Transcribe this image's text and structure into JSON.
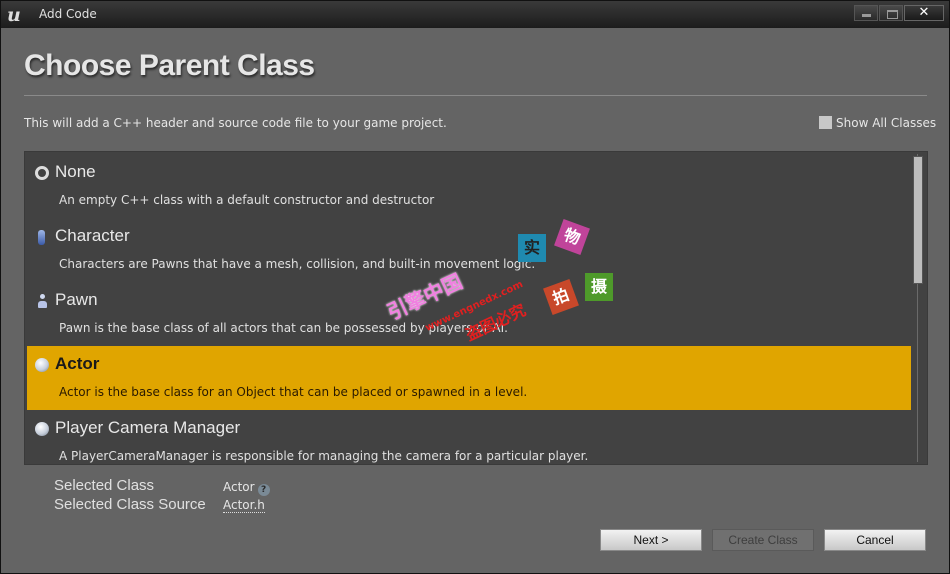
{
  "window": {
    "title": "Add Code",
    "controls": {
      "minimize": "minimize",
      "maximize": "maximize",
      "close": "✕"
    }
  },
  "header": {
    "title": "Choose Parent Class",
    "description": "This will add a C++ header and source code file to your game project.",
    "show_all_classes_label": "Show All Classes",
    "show_all_classes_checked": false
  },
  "classes": [
    {
      "name": "None",
      "description": "An empty C++ class with a default constructor and destructor",
      "icon": "empty-circle-icon",
      "selected": false
    },
    {
      "name": "Character",
      "description": "Characters are Pawns that have a mesh, collision, and built-in movement logic.",
      "icon": "character-icon",
      "selected": false
    },
    {
      "name": "Pawn",
      "description": "Pawn is the base class of all actors that can be possessed by players or AI.",
      "icon": "pawn-icon",
      "selected": false
    },
    {
      "name": "Actor",
      "description": "Actor is the base class for an Object that can be placed or spawned in a level.",
      "icon": "sphere-icon",
      "selected": true
    },
    {
      "name": "Player Camera Manager",
      "description": "A PlayerCameraManager is responsible for managing the camera for a particular player.",
      "icon": "sphere-icon",
      "selected": false
    }
  ],
  "selection": {
    "class_label": "Selected Class",
    "class_value": "Actor",
    "source_label": "Selected Class Source",
    "source_value": "Actor.h",
    "help_glyph": "?"
  },
  "buttons": {
    "next": "Next >",
    "create_class": "Create Class",
    "cancel": "Cancel"
  },
  "watermark": {
    "text1": "引擎中国",
    "text2": "www.engnedx.com",
    "text3": "盗图必究",
    "box1": "实",
    "box2": "物",
    "box3": "拍",
    "box4": "摄",
    "colors": {
      "box1": "#1f8ab0",
      "box2": "#c0449a",
      "box3": "#c8482a",
      "box4": "#4e9a2a"
    }
  },
  "colors": {
    "selected_row": "#e0a500",
    "list_bg": "#424242",
    "window_bg": "#646464"
  }
}
